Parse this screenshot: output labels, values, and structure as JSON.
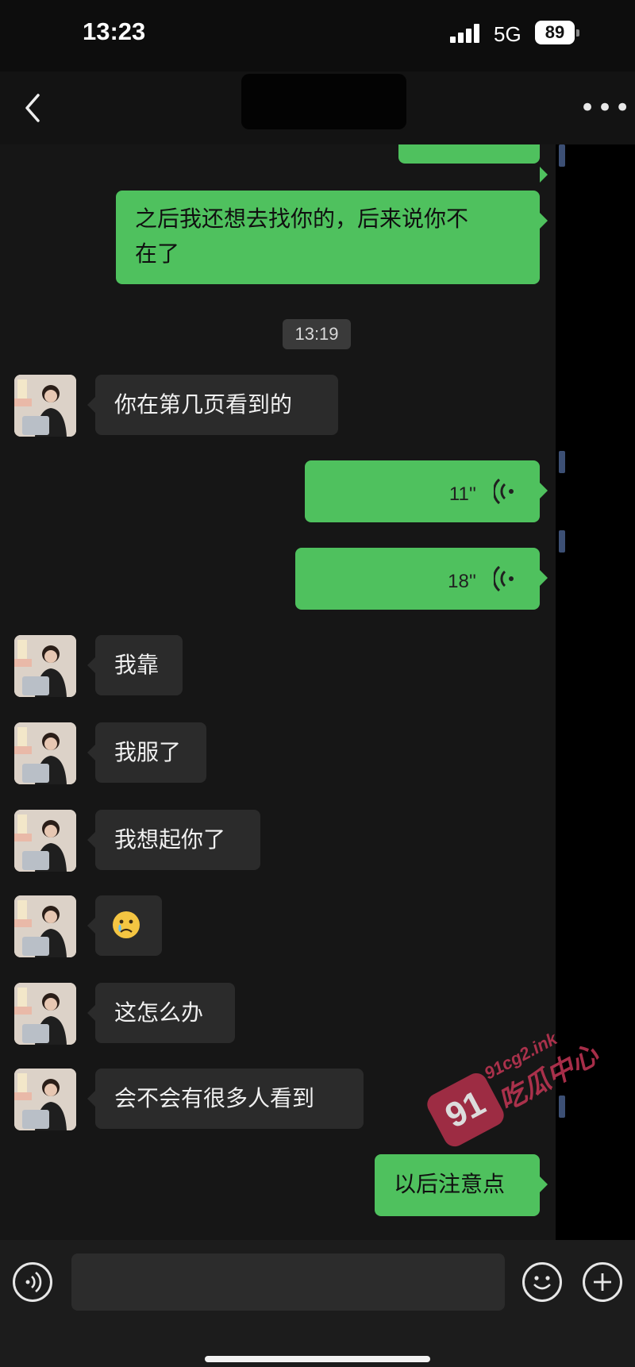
{
  "status": {
    "time": "13:23",
    "network": "5G",
    "battery": "89"
  },
  "header": {
    "back_icon": "chevron-left-icon",
    "more_icon": "more-dots-icon",
    "more_label": "•••"
  },
  "messages": [
    {
      "side": "out",
      "type": "text",
      "text": "之后我还想去找你的，后来说你不",
      "text2": "在了"
    },
    {
      "type": "timestamp",
      "text": "13:19"
    },
    {
      "side": "in",
      "type": "text",
      "text": "你在第几页看到的"
    },
    {
      "side": "out",
      "type": "voice",
      "duration": "11''"
    },
    {
      "side": "out",
      "type": "voice",
      "duration": "18''"
    },
    {
      "side": "in",
      "type": "text",
      "text": "我靠"
    },
    {
      "side": "in",
      "type": "text",
      "text": "我服了"
    },
    {
      "side": "in",
      "type": "text",
      "text": "我想起你了"
    },
    {
      "side": "in",
      "type": "emoji",
      "emoji": "crying-face-emoji"
    },
    {
      "side": "in",
      "type": "text",
      "text": "这怎么办"
    },
    {
      "side": "in",
      "type": "text",
      "text": "会不会有很多人看到"
    },
    {
      "side": "out",
      "type": "text",
      "text": "以后注意点"
    }
  ],
  "watermark": {
    "badge": "91",
    "url": "91cg2.ink",
    "name": "吃瓜中心"
  },
  "input_bar": {
    "placeholder": "",
    "voice_icon": "voice-icon",
    "emoji_icon": "emoji-icon",
    "add_icon": "add-icon"
  },
  "colors": {
    "outgoing_bubble": "#4fc15e",
    "incoming_bubble": "#2b2b2b",
    "background": "#161616"
  }
}
